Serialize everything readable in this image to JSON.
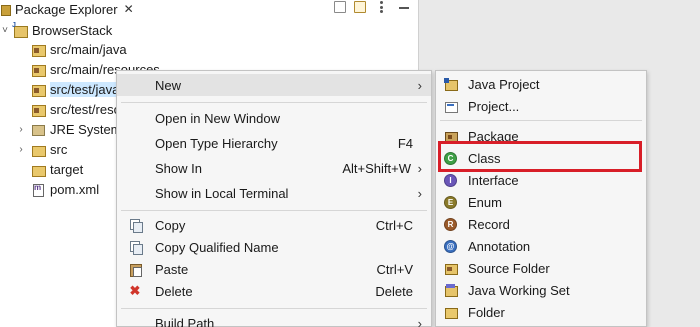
{
  "view": {
    "tab_title": "Package Explorer",
    "close_glyph": "✕",
    "toolbar_icons": [
      "collapse-all-icon",
      "link-with-editor-icon",
      "view-menu-icon",
      "minimize-icon",
      "maximize-icon"
    ]
  },
  "tree": {
    "project": "BrowserStack",
    "items": [
      {
        "label": "src/main/java",
        "icon": "source-folder-icon"
      },
      {
        "label": "src/main/resources",
        "icon": "source-folder-icon"
      },
      {
        "label": "src/test/java",
        "icon": "source-folder-icon",
        "selected": true
      },
      {
        "label": "src/test/resources",
        "icon": "source-folder-icon"
      },
      {
        "label": "JRE System Library",
        "icon": "library-icon",
        "expandable": true
      },
      {
        "label": "src",
        "icon": "folder-icon",
        "expandable": true
      },
      {
        "label": "target",
        "icon": "folder-icon"
      },
      {
        "label": "pom.xml",
        "icon": "maven-file-icon"
      }
    ]
  },
  "context_menu": {
    "new": "New",
    "open_new_window": "Open in New Window",
    "open_type_hierarchy": "Open Type Hierarchy",
    "open_type_hierarchy_sc": "F4",
    "show_in": "Show In",
    "show_in_sc": "Alt+Shift+W",
    "show_in_terminal": "Show in Local Terminal",
    "copy": "Copy",
    "copy_sc": "Ctrl+C",
    "copy_qualified": "Copy Qualified Name",
    "paste": "Paste",
    "paste_sc": "Ctrl+V",
    "delete": "Delete",
    "delete_sc": "Delete",
    "build_path": "Build Path",
    "submenu_arrow": "›"
  },
  "new_submenu": {
    "java_project": "Java Project",
    "project": "Project...",
    "package": "Package",
    "class": "Class",
    "interface": "Interface",
    "enum": "Enum",
    "record": "Record",
    "annotation": "Annotation",
    "source_folder": "Source Folder",
    "java_working_set": "Java Working Set",
    "folder": "Folder",
    "icon_letters": {
      "class": "C",
      "interface": "I",
      "enum": "E",
      "record": "R",
      "annotation": "@"
    }
  },
  "highlight": {
    "target": "Class",
    "color": "#d81e28"
  },
  "colors": {
    "selection": "#cde8ff",
    "menu_bg": "#f6f6f6",
    "editor_area": "#e9e9e9"
  }
}
